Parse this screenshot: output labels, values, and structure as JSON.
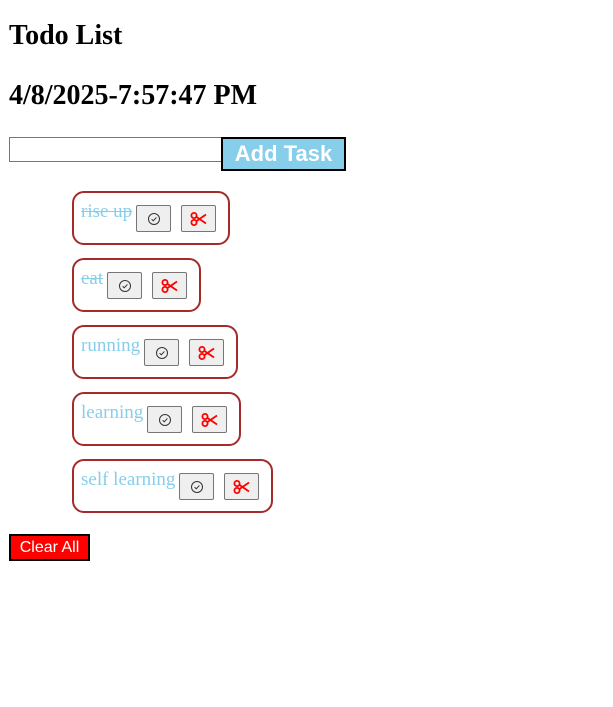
{
  "header": {
    "title": "Todo List",
    "datetime": "4/8/2025-7:57:47 PM"
  },
  "form": {
    "input_value": "",
    "input_placeholder": "",
    "add_label": "Add Task"
  },
  "tasks": [
    {
      "text": "rise up",
      "done": true
    },
    {
      "text": "eat",
      "done": true
    },
    {
      "text": "running",
      "done": false
    },
    {
      "text": "learning",
      "done": false
    },
    {
      "text": "self learning",
      "done": false
    }
  ],
  "icons": {
    "done": "check-circle-icon",
    "delete": "scissors-icon"
  },
  "colors": {
    "task_text": "#87ceeb",
    "task_border": "#a52a2a",
    "add_button_bg": "#87ceeb",
    "clear_button_bg": "#ff0000",
    "delete_icon": "#ff0000"
  },
  "footer": {
    "clear_label": "Clear All"
  }
}
